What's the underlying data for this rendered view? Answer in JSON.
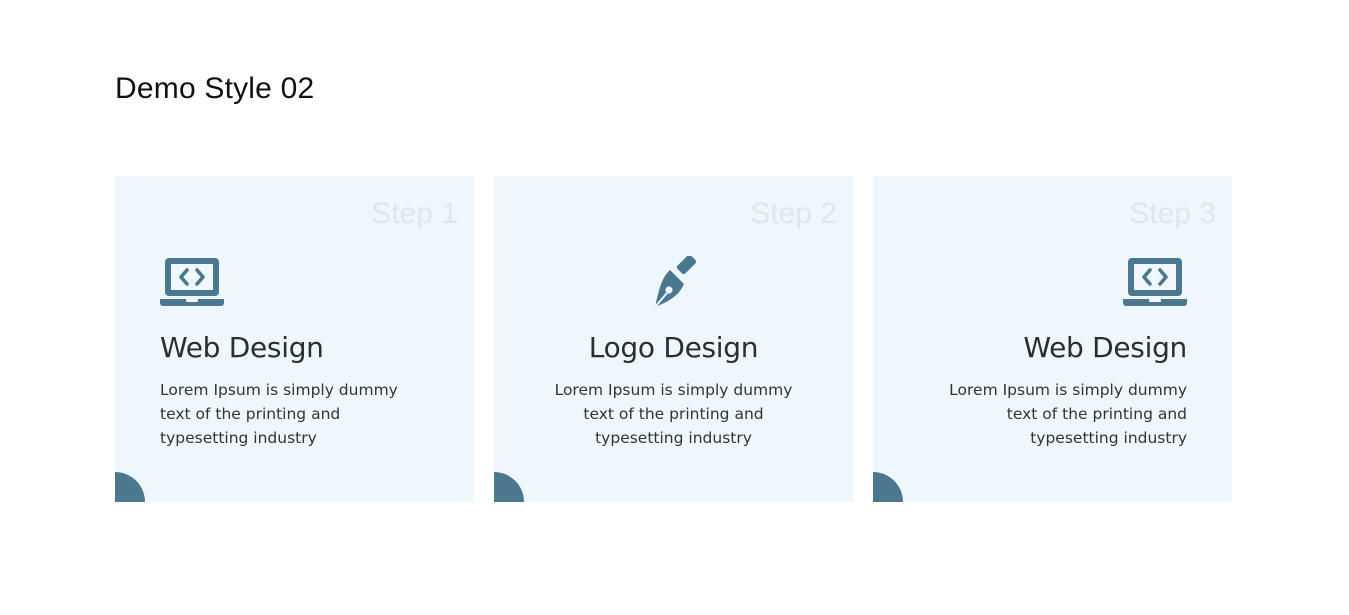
{
  "page": {
    "title": "Demo Style 02"
  },
  "colors": {
    "card_bg": "#eef8fc",
    "accent": "#4b788e",
    "step_text": "#dfe7ee"
  },
  "cards": [
    {
      "step": "Step 1",
      "icon": "laptop-code-icon",
      "title": "Web Design",
      "description": "Lorem Ipsum is simply dummy text of the printing and typesetting industry",
      "align": "left"
    },
    {
      "step": "Step 2",
      "icon": "pen-nib-icon",
      "title": "Logo Design",
      "description": "Lorem Ipsum is simply dummy text of the printing and typesetting industry",
      "align": "center"
    },
    {
      "step": "Step 3",
      "icon": "laptop-code-icon",
      "title": "Web Design",
      "description": "Lorem Ipsum is simply dummy text of the printing and typesetting industry",
      "align": "right"
    }
  ]
}
